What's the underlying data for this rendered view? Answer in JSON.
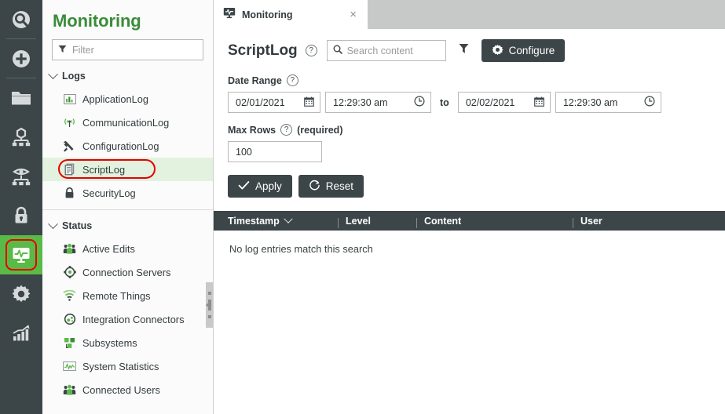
{
  "rail": {
    "items": [
      {
        "name": "search",
        "icon": "search-icon",
        "active": false,
        "separator_after": true
      },
      {
        "name": "add",
        "icon": "plus-circle-icon",
        "active": false,
        "separator_after": true
      },
      {
        "name": "browse",
        "icon": "folder-icon",
        "active": false,
        "separator_after": false
      },
      {
        "name": "modeling",
        "icon": "hierarchy-icon",
        "active": false,
        "separator_after": false
      },
      {
        "name": "visualization",
        "icon": "eye-hierarchy-icon",
        "active": false,
        "separator_after": false
      },
      {
        "name": "security",
        "icon": "lock-icon",
        "active": false,
        "separator_after": false
      },
      {
        "name": "monitoring",
        "icon": "monitor-pulse-icon",
        "active": true,
        "separator_after": false
      },
      {
        "name": "configuration",
        "icon": "gear-icon",
        "active": false,
        "separator_after": false
      },
      {
        "name": "analytics",
        "icon": "bar-chart-icon",
        "active": false,
        "separator_after": false
      }
    ],
    "active_highlight_color": "#5aba47",
    "highlight_ring_color": "#e60000",
    "background_color": "#3c4548"
  },
  "sidebar": {
    "title": "Monitoring",
    "title_color": "#3a8c3a",
    "filter": {
      "placeholder": "Filter",
      "icon": "funnel-icon"
    },
    "groups": [
      {
        "label": "Logs",
        "expanded": true,
        "items": [
          {
            "label": "ApplicationLog",
            "icon": "bar-chart-log-icon",
            "selected": false
          },
          {
            "label": "CommunicationLog",
            "icon": "antenna-icon",
            "selected": false
          },
          {
            "label": "ConfigurationLog",
            "icon": "tools-icon",
            "selected": false
          },
          {
            "label": "ScriptLog",
            "icon": "script-document-icon",
            "selected": true,
            "highlighted": true
          },
          {
            "label": "SecurityLog",
            "icon": "lock-icon",
            "selected": false
          }
        ]
      },
      {
        "label": "Status",
        "expanded": true,
        "items": [
          {
            "label": "Active Edits",
            "icon": "users-group-icon",
            "selected": false
          },
          {
            "label": "Connection Servers",
            "icon": "connection-node-icon",
            "selected": false
          },
          {
            "label": "Remote Things",
            "icon": "wifi-icon",
            "selected": false
          },
          {
            "label": "Integration Connectors",
            "icon": "connector-circle-icon",
            "selected": false
          },
          {
            "label": "Subsystems",
            "icon": "subsystem-blocks-icon",
            "selected": false
          },
          {
            "label": "System Statistics",
            "icon": "pulse-chart-icon",
            "selected": false
          },
          {
            "label": "Connected Users",
            "icon": "users-group-icon",
            "selected": false
          }
        ]
      }
    ],
    "splitter": {
      "name": "panel-collapse-handle"
    }
  },
  "tab": {
    "label": "Monitoring",
    "icon": "monitor-pulse-icon",
    "close_label": "×"
  },
  "toolbar": {
    "page_title": "ScriptLog",
    "help_glyph": "?",
    "search": {
      "placeholder": "Search content",
      "value": "",
      "icon": "search-icon"
    },
    "filter_icon": "funnel-icon",
    "configure_label": "Configure",
    "configure_icon": "gear-icon"
  },
  "form": {
    "date_range": {
      "label": "Date Range",
      "help_glyph": "?",
      "start_date": "02/01/2021",
      "start_time": "12:29:30 am",
      "to_label": "to",
      "end_date": "02/02/2021",
      "end_time": "12:29:30 am",
      "calendar_icon": "calendar-icon",
      "clock_icon": "clock-icon"
    },
    "max_rows": {
      "label": "Max Rows",
      "help_glyph": "?",
      "required_note": "(required)",
      "value": "100"
    },
    "apply_label": "Apply",
    "apply_icon": "check-icon",
    "reset_label": "Reset",
    "reset_icon": "reset-circle-icon"
  },
  "table": {
    "columns": [
      {
        "label": "Timestamp",
        "sorted": true,
        "sort_icon": "chevron-down-icon"
      },
      {
        "label": "Level",
        "sorted": false
      },
      {
        "label": "Content",
        "sorted": false
      },
      {
        "label": "User",
        "sorted": false
      }
    ],
    "rows": [],
    "empty_message": "No log entries match this search",
    "header_background": "#3c4548"
  }
}
